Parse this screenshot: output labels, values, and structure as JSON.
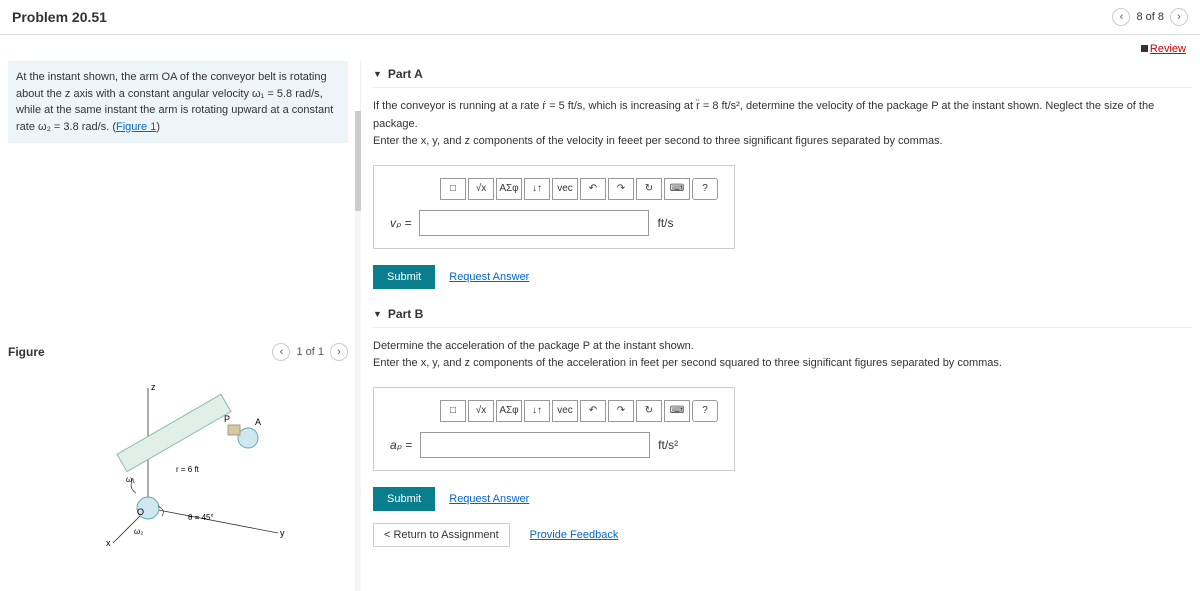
{
  "header": {
    "title": "Problem 20.51",
    "page": "8 of 8"
  },
  "review": "Review",
  "desc": {
    "l1": "At the instant shown, the arm OA of the conveyor belt is rotating about the z axis with",
    "l2": "a constant angular velocity ω₁ = 5.8 rad/s, while at the same instant the arm is",
    "l3": "rotating upward at a constant rate ω₂ = 3.8 rad/s. (",
    "figlink": "Figure 1",
    "l3b": ")"
  },
  "figure": {
    "label": "Figure",
    "nav": "1 of 1",
    "r": "r = 6 ft",
    "theta": "θ = 45°",
    "w1": "ω₁",
    "w2": "ω₂",
    "A": "A",
    "P": "P",
    "O": "O",
    "x": "x",
    "y": "y",
    "z": "z"
  },
  "partA": {
    "title": "Part A",
    "q1": "If the conveyor is running at a rate ṙ = 5 ft/s, which is increasing at r̈ = 8 ft/s², determine the velocity of the package P at the instant shown. Neglect the size of the package.",
    "q2": "Enter the x, y, and z components of the velocity in feeet per second to three significant figures separated by commas.",
    "var": "vₚ =",
    "unit": "ft/s",
    "submit": "Submit",
    "req": "Request Answer"
  },
  "partB": {
    "title": "Part B",
    "q1": "Determine the acceleration of the package P at the instant shown.",
    "q2": "Enter the x, y, and z components of the acceleration in feet per second squared to three significant figures separated by commas.",
    "var": "aₚ =",
    "unit": "ft/s²",
    "submit": "Submit",
    "req": "Request Answer"
  },
  "tools": {
    "t1": "□",
    "t2": "√x",
    "t3": "ΑΣφ",
    "t4": "↓↑",
    "t5": "vec",
    "t6": "↶",
    "t7": "↷",
    "t8": "↻",
    "t9": "⌨",
    "t10": "?"
  },
  "footer": {
    "ret": "< Return to Assignment",
    "fb": "Provide Feedback"
  }
}
